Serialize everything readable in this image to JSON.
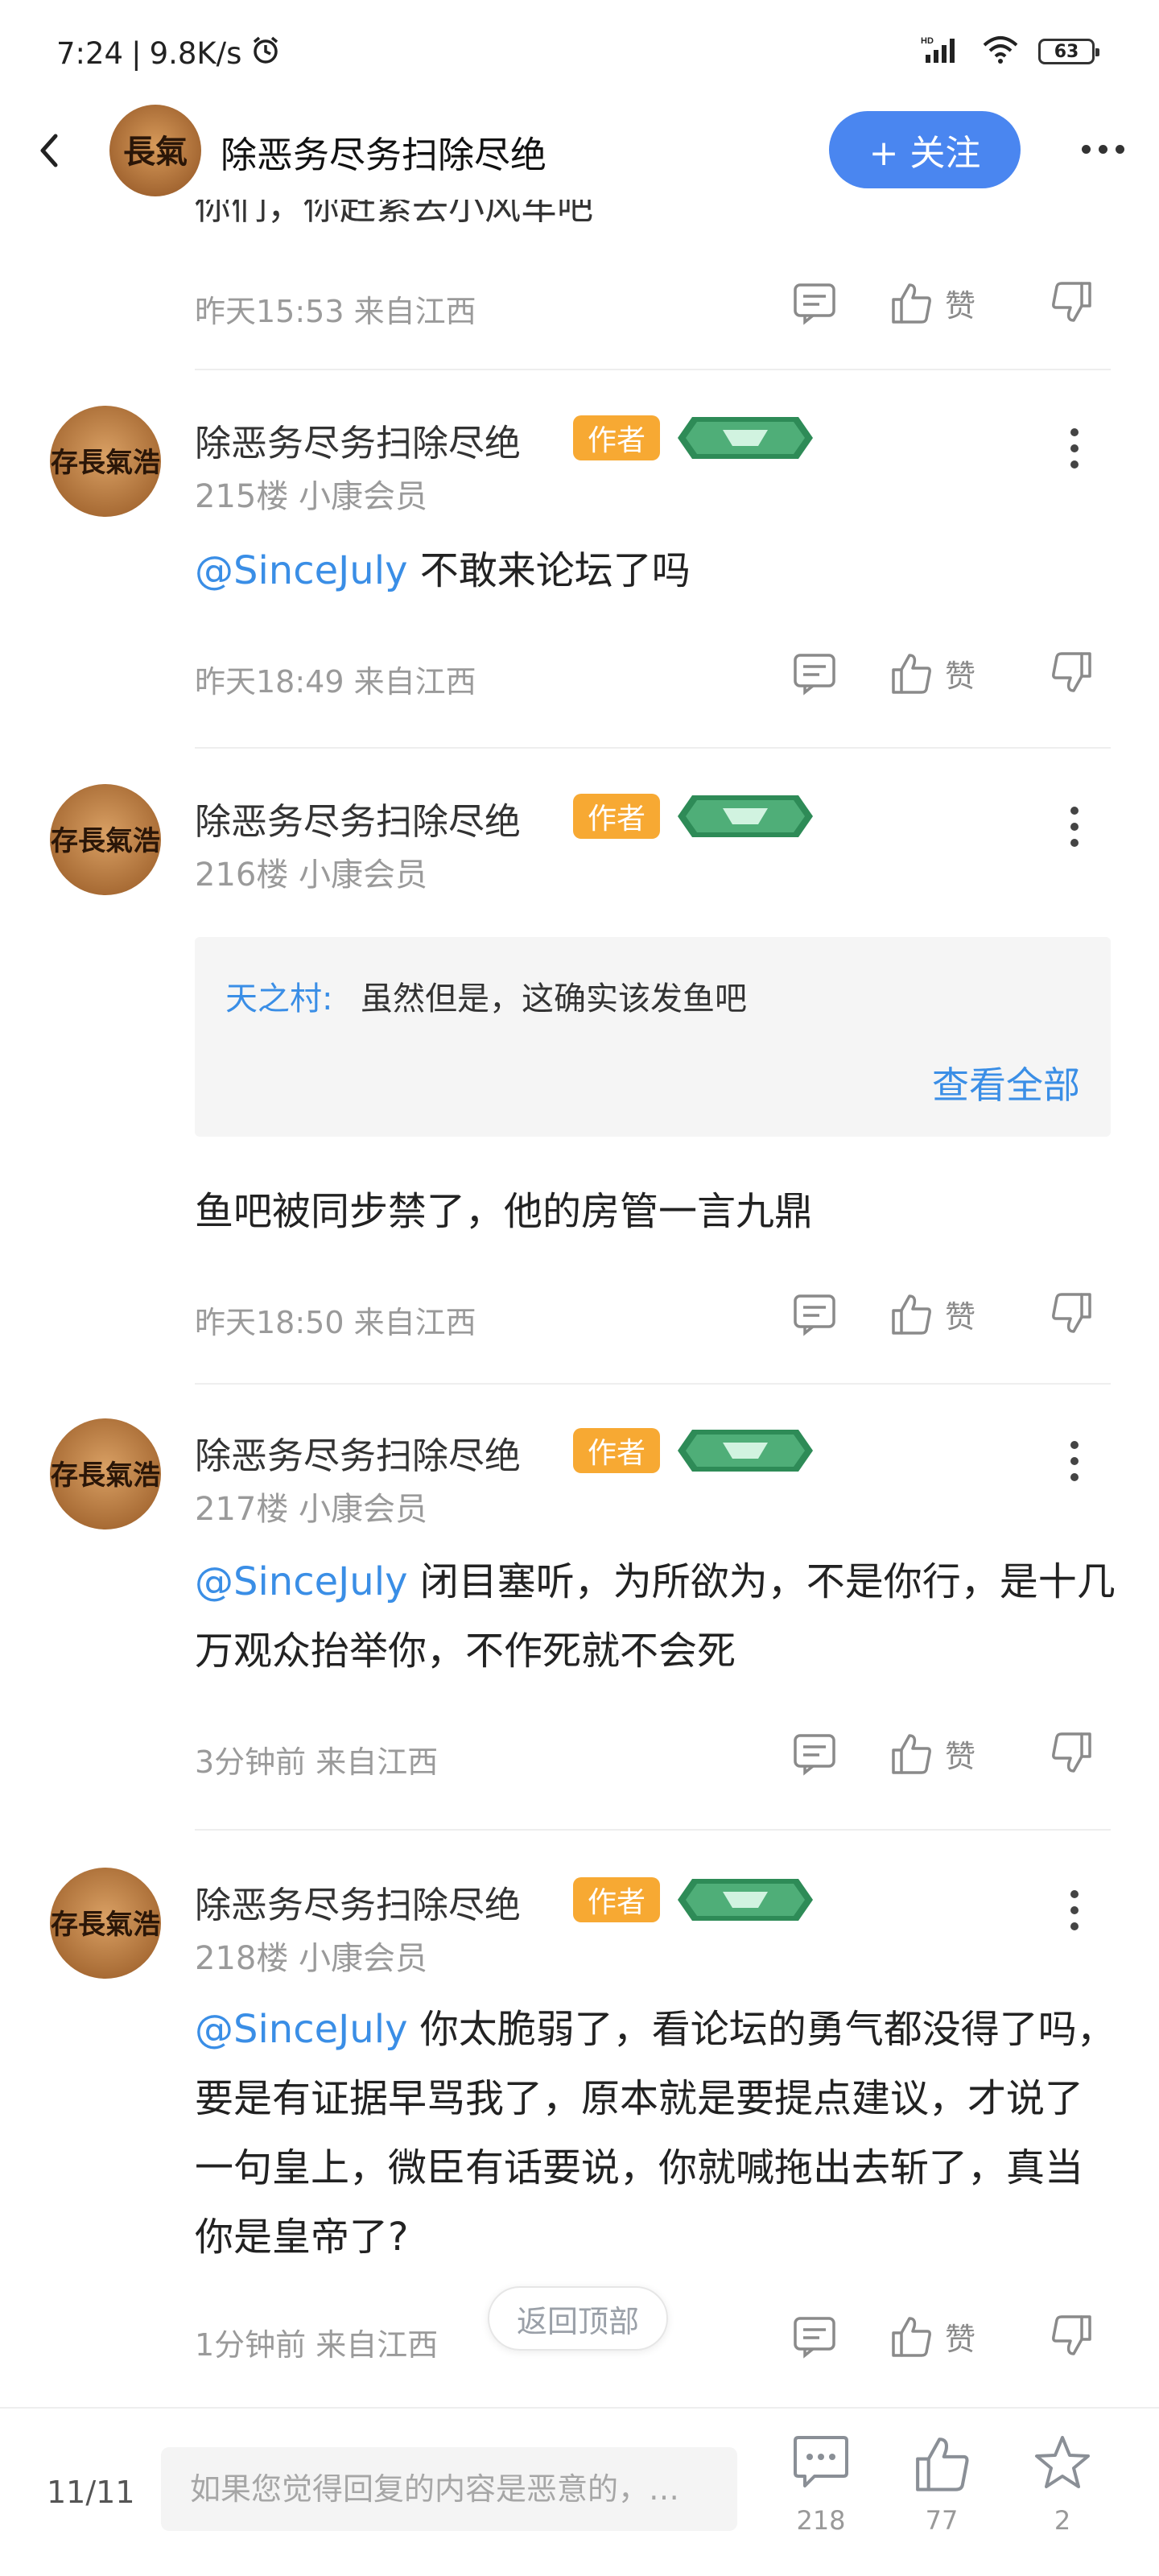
{
  "status_bar": {
    "time": "7:24",
    "speed": "9.8K/s",
    "battery": "63"
  },
  "header": {
    "title": "除恶务尽务扫除尽绝",
    "follow_label": "+ 关注",
    "avatar_text": "長氣"
  },
  "top_fragment": {
    "cut_text": "你们，你赶紧去小风车吧",
    "meta": "昨天15:53 来自江西",
    "like_label": "赞"
  },
  "posts": [
    {
      "username": "除恶务尽务扫除尽绝",
      "author_badge": "作者",
      "floor": "215楼 小康会员",
      "mention": "@SinceJuly",
      "text": " 不敢来论坛了吗",
      "meta": "昨天18:49 来自江西",
      "like_label": "赞"
    },
    {
      "username": "除恶务尽务扫除尽绝",
      "author_badge": "作者",
      "floor": "216楼 小康会员",
      "quote": {
        "name": "天之村:",
        "text": "虽然但是，这确实该发鱼吧",
        "more": "查看全部"
      },
      "text": "鱼吧被同步禁了，他的房管一言九鼎",
      "meta": "昨天18:50 来自江西",
      "like_label": "赞"
    },
    {
      "username": "除恶务尽务扫除尽绝",
      "author_badge": "作者",
      "floor": "217楼 小康会员",
      "mention": "@SinceJuly",
      "text": " 闭目塞听，为所欲为，不是你行，是十几万观众抬举你，不作死就不会死",
      "meta": "3分钟前 来自江西",
      "like_label": "赞"
    },
    {
      "username": "除恶务尽务扫除尽绝",
      "author_badge": "作者",
      "floor": "218楼 小康会员",
      "mention": "@SinceJuly",
      "text": " 你太脆弱了，看论坛的勇气都没得了吗，要是有证据早骂我了，原本就是要提点建议，才说了一句皇上，微臣有话要说，你就喊拖出去斩了，真当你是皇帝了?",
      "meta": "1分钟前 来自江西",
      "like_label": "赞"
    }
  ],
  "avatar_text": "存長氣浩",
  "back_to_top": "返回顶部",
  "bottom_bar": {
    "page": "11/11",
    "placeholder": "如果您觉得回复的内容是恶意的，…",
    "comments": "218",
    "likes": "77",
    "stars": "2"
  },
  "colors": {
    "accent": "#4a86f0",
    "mention": "#3a8ee6",
    "author_badge": "#f7a933",
    "level_badge": "#2e8b57"
  }
}
